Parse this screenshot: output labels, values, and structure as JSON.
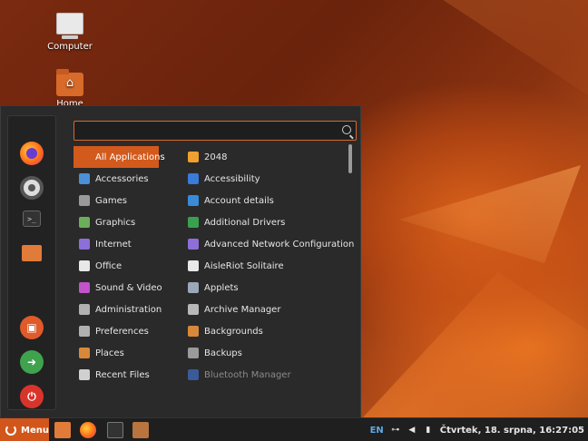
{
  "desktop": {
    "icons": [
      {
        "label": "Computer",
        "icon": "computer-icon"
      },
      {
        "label": "Home",
        "icon": "home-folder-icon"
      }
    ]
  },
  "menu": {
    "search": {
      "value": "",
      "placeholder": ""
    },
    "favorites": [
      {
        "name": "Firefox",
        "icon": "firefox-icon"
      },
      {
        "name": "Settings",
        "icon": "settings-icon"
      },
      {
        "name": "Terminal",
        "icon": "terminal-icon"
      },
      {
        "name": "Files",
        "icon": "folder-icon"
      },
      {
        "name": "Lock Screen",
        "icon": "lock-icon"
      },
      {
        "name": "Log Out",
        "icon": "logout-icon"
      },
      {
        "name": "Shut Down",
        "icon": "power-icon"
      }
    ],
    "categories": [
      {
        "label": "All Applications",
        "active": true,
        "color": "#d25a1c"
      },
      {
        "label": "Accessories",
        "color": "#4a8fd8"
      },
      {
        "label": "Games",
        "color": "#9a9a9a"
      },
      {
        "label": "Graphics",
        "color": "#6cae5a"
      },
      {
        "label": "Internet",
        "color": "#8c6fd8"
      },
      {
        "label": "Office",
        "color": "#e8e8e8"
      },
      {
        "label": "Sound & Video",
        "color": "#c054c8"
      },
      {
        "label": "Administration",
        "color": "#b0b0b0"
      },
      {
        "label": "Preferences",
        "color": "#b0b0b0"
      },
      {
        "label": "Places",
        "color": "#d8883a"
      },
      {
        "label": "Recent Files",
        "color": "#d0d0d0"
      }
    ],
    "applications": [
      {
        "label": "2048",
        "color": "#f0a030"
      },
      {
        "label": "Accessibility",
        "color": "#3a7ad8"
      },
      {
        "label": "Account details",
        "color": "#3a8ad8"
      },
      {
        "label": "Additional Drivers",
        "color": "#3aa050"
      },
      {
        "label": "Advanced Network Configuration",
        "color": "#8c6fd8"
      },
      {
        "label": "AisleRiot Solitaire",
        "color": "#e8e8e8"
      },
      {
        "label": "Applets",
        "color": "#9aa8b8"
      },
      {
        "label": "Archive Manager",
        "color": "#b8b8b8"
      },
      {
        "label": "Backgrounds",
        "color": "#d8883a"
      },
      {
        "label": "Backups",
        "color": "#9a9a9a"
      },
      {
        "label": "Bluetooth Manager",
        "color": "#3a5a98",
        "dim": true
      }
    ]
  },
  "panel": {
    "menu_label": "Menu",
    "tray": {
      "keyboard_layout": "EN",
      "clock": "Čtvrtek, 18. srpna, 16:27:05"
    }
  }
}
